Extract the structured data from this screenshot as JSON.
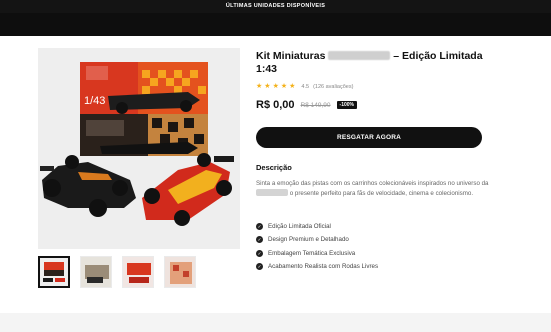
{
  "announcement": {
    "text": "ÚLTIMAS UNIDADES DISPONÍVEIS"
  },
  "product": {
    "title_part1": "Kit Miniaturas",
    "title_part2": "– Edição Limitada 1:43",
    "rating_value": "4.5",
    "rating_count": "(126 avaliações)",
    "price": "R$ 0,00",
    "old_price": "R$ 149,90",
    "discount_badge": "-100%",
    "cta_label": "RESGATAR AGORA",
    "box_scale_label": "1/43"
  },
  "description": {
    "heading": "Descrição",
    "text_part1": "Sinta a emoção das pistas com os carrinhos colecionáveis inspirados no universo da",
    "text_part2": "o presente perfeito para fãs de velocidade, cinema e colecionismo."
  },
  "features": [
    {
      "label": "Edição Limitada Oficial"
    },
    {
      "label": "Design Premium e Detalhado"
    },
    {
      "label": "Embalagem Temática Exclusiva"
    },
    {
      "label": "Acabamento Realista com Rodas Livres"
    }
  ],
  "gallery": {
    "thumb_count": 4,
    "active_index": 0
  },
  "colors": {
    "accent": "#111111",
    "star": "#f4b21b",
    "box_red": "#d8371f",
    "box_orange": "#f08a1c"
  },
  "icons": {
    "feature_bullet": "check-circle-icon",
    "rating": "star-icon"
  }
}
